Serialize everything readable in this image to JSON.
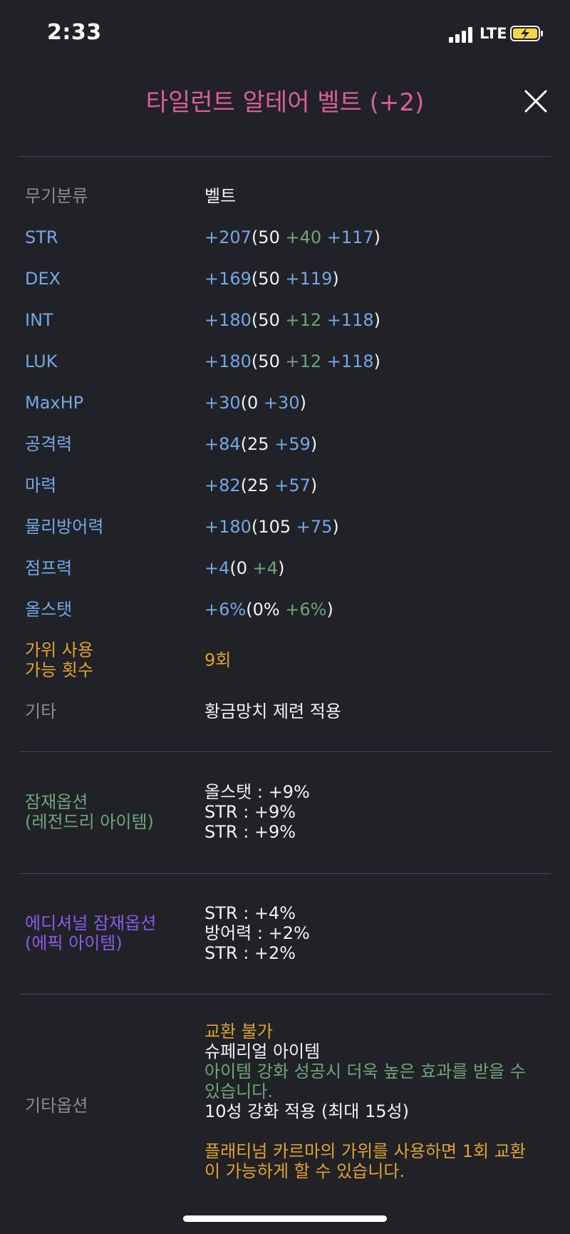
{
  "status_bar": {
    "time": "2:33",
    "network": "LTE"
  },
  "header": {
    "title": "타일런트 알테어 벨트 (+2)"
  },
  "stats": {
    "weapon_type": {
      "label": "무기분류",
      "value": "벨트"
    },
    "str": {
      "label": "STR",
      "total": "+207",
      "open": "(",
      "base": "50 ",
      "bonus": "+40",
      "enhance": " +117",
      "close": ")"
    },
    "dex": {
      "label": "DEX",
      "total": "+169",
      "open": "(",
      "base": "50 ",
      "enhance": "+119",
      "close": ")"
    },
    "int": {
      "label": "INT",
      "total": "+180",
      "open": "(",
      "base": "50 ",
      "bonus": "+12",
      "enhance": " +118",
      "close": ")"
    },
    "luk": {
      "label": "LUK",
      "total": "+180",
      "open": "(",
      "base": "50 ",
      "bonus": "+12",
      "enhance": " +118",
      "close": ")"
    },
    "maxhp": {
      "label": "MaxHP",
      "total": "+30",
      "open": "(",
      "base": "0 ",
      "enhance": "+30",
      "close": ")"
    },
    "attack": {
      "label": "공격력",
      "total": "+84",
      "open": "(",
      "base": "25 ",
      "enhance": "+59",
      "close": ")"
    },
    "magic": {
      "label": "마력",
      "total": "+82",
      "open": "(",
      "base": "25 ",
      "enhance": "+57",
      "close": ")"
    },
    "defense": {
      "label": "물리방어력",
      "total": "+180",
      "open": "(",
      "base": "105 ",
      "enhance": "+75",
      "close": ")"
    },
    "jump": {
      "label": "점프력",
      "total": "+4",
      "open": "(",
      "base": "0 ",
      "bonus": "+4",
      "close": ")"
    },
    "allstat": {
      "label": "올스탯",
      "total": "+6%",
      "open": "(",
      "base": "0% ",
      "bonus": "+6%",
      "close": ")"
    },
    "scissors": {
      "label_line1": "가위 사용",
      "label_line2": "가능 횟수",
      "value": "9회"
    },
    "misc": {
      "label": "기타",
      "value": "황금망치 제련 적용"
    }
  },
  "potential": {
    "label_line1": "잠재옵션",
    "label_line2": "(레전드리 아이템)",
    "lines": [
      "올스탯 : +9%",
      "STR : +9%",
      "STR : +9%"
    ]
  },
  "additional_potential": {
    "label_line1": "에디셔널 잠재옵션",
    "label_line2": "(에픽 아이템)",
    "lines": [
      "STR : +4%",
      "방어력 : +2%",
      "STR : +2%"
    ]
  },
  "other_options": {
    "label": "기타옵션",
    "trade": "교환 불가",
    "superior": "슈페리얼 아이템",
    "enhance_note": "아이템 강화 성공시 더욱 높은 효과를 받을 수 있습니다.",
    "stars": "10성 강화 적용 (최대 15성)",
    "karma": "플래티넘 카르마의 가위를 사용하면 1회 교환이 가능하게 할 수 있습니다."
  },
  "colors": {
    "background": "#212227",
    "title": "#d95f93",
    "stat_label": "#73a7e6",
    "bonus": "#6fa37d",
    "scissors": "#e1a22e",
    "potential": "#6fa37d",
    "additional": "#8b5ae6"
  },
  "icons": [
    "signal-icon",
    "battery-charging-icon",
    "close-icon"
  ]
}
